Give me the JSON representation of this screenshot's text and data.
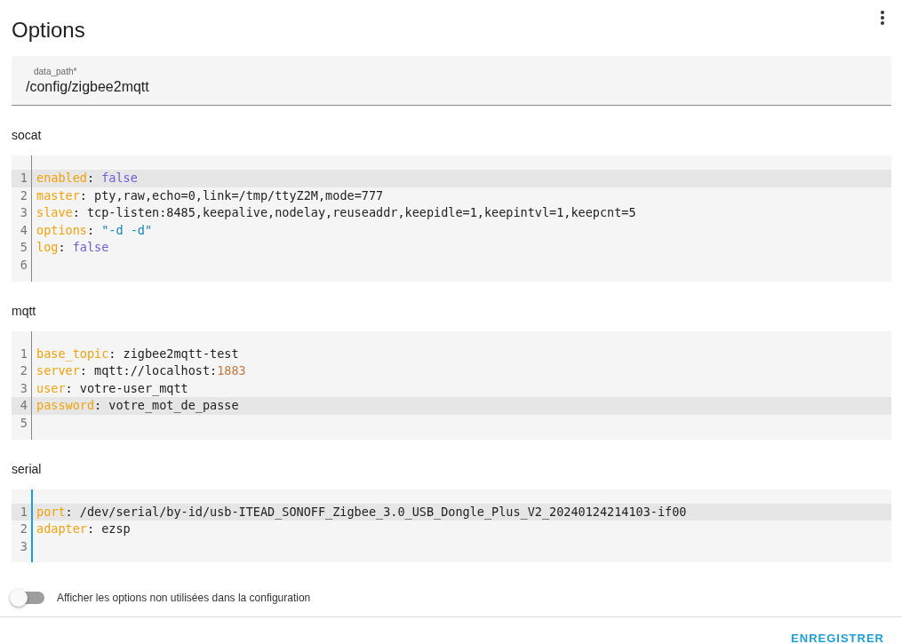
{
  "title": "Options",
  "data_path": {
    "label": "data_path*",
    "value": "/config/zigbee2mqtt"
  },
  "sections": [
    {
      "title": "socat",
      "focused": false,
      "lines": [
        {
          "number": "1",
          "active": true,
          "segments": [
            {
              "text": "enabled",
              "kind": "key"
            },
            {
              "text": ": ",
              "kind": "plain"
            },
            {
              "text": "false",
              "kind": "bool"
            }
          ]
        },
        {
          "number": "2",
          "active": false,
          "segments": [
            {
              "text": "master",
              "kind": "key"
            },
            {
              "text": ": pty,raw,echo=0,link=/tmp/ttyZ2M,mode=777",
              "kind": "plain"
            }
          ]
        },
        {
          "number": "3",
          "active": false,
          "segments": [
            {
              "text": "slave",
              "kind": "key"
            },
            {
              "text": ": tcp-listen:8485,keepalive,nodelay,reuseaddr,keepidle=1,keepintvl=1,keepcnt=5",
              "kind": "plain"
            }
          ]
        },
        {
          "number": "4",
          "active": false,
          "segments": [
            {
              "text": "options",
              "kind": "key"
            },
            {
              "text": ": ",
              "kind": "plain"
            },
            {
              "text": "\"-d -d\"",
              "kind": "string"
            }
          ]
        },
        {
          "number": "5",
          "active": false,
          "segments": [
            {
              "text": "log",
              "kind": "key"
            },
            {
              "text": ": ",
              "kind": "plain"
            },
            {
              "text": "false",
              "kind": "bool"
            }
          ]
        },
        {
          "number": "6",
          "active": false
        }
      ]
    },
    {
      "title": "mqtt",
      "focused": false,
      "lines": [
        {
          "number": "1",
          "active": false,
          "segments": [
            {
              "text": "base_topic",
              "kind": "key"
            },
            {
              "text": ": zigbee2mqtt-test",
              "kind": "plain"
            }
          ]
        },
        {
          "number": "2",
          "active": false,
          "segments": [
            {
              "text": "server",
              "kind": "key"
            },
            {
              "text": ": mqtt://localhost:",
              "kind": "plain"
            },
            {
              "text": "1883",
              "kind": "number"
            }
          ]
        },
        {
          "number": "3",
          "active": false,
          "segments": [
            {
              "text": "user",
              "kind": "key"
            },
            {
              "text": ": votre-user_mqtt",
              "kind": "plain"
            }
          ]
        },
        {
          "number": "4",
          "active": true,
          "segments": [
            {
              "text": "password",
              "kind": "key"
            },
            {
              "text": ": votre_mot_de_passe",
              "kind": "plain"
            }
          ]
        },
        {
          "number": "5",
          "active": false
        }
      ]
    },
    {
      "title": "serial",
      "focused": true,
      "lines": [
        {
          "number": "1",
          "active": true,
          "segments": [
            {
              "text": "port",
              "kind": "key"
            },
            {
              "text": ": /dev/serial/by-id/usb-ITEAD_SONOFF_Zigbee_3.0_USB_Dongle_Plus_V2_20240124214103-if00",
              "kind": "plain"
            }
          ]
        },
        {
          "number": "2",
          "active": false,
          "segments": [
            {
              "text": "adapter",
              "kind": "key"
            },
            {
              "text": ": ezsp",
              "kind": "plain"
            }
          ]
        },
        {
          "number": "3",
          "active": false
        }
      ]
    }
  ],
  "toggle": {
    "label": "Afficher les options non utilisées dans la configuration",
    "on": false
  },
  "save_button": "ENREGISTRER"
}
